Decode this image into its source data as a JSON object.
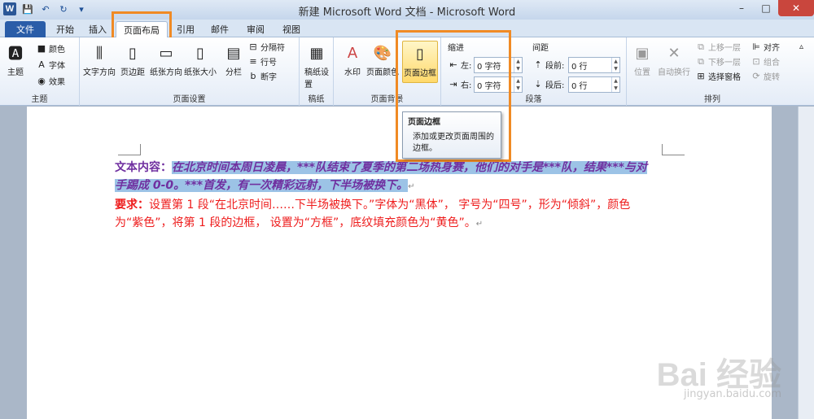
{
  "title": "新建 Microsoft Word 文档 - Microsoft Word",
  "qat": {
    "logo": "W",
    "save": "💾",
    "undo": "↶",
    "redo": "↻",
    "more": "▾"
  },
  "window": {
    "min": "–",
    "max": "□",
    "close": "✕"
  },
  "tabs": [
    "文件",
    "开始",
    "插入",
    "页面布局",
    "引用",
    "邮件",
    "审阅",
    "视图"
  ],
  "ribbon": {
    "theme": {
      "btn": "主题",
      "colors": "颜色",
      "fonts": "字体",
      "effects": "效果",
      "label": "主题"
    },
    "page_setup": {
      "text_dir": "文字方向",
      "margins": "页边距",
      "orientation": "纸张方向",
      "size": "纸张大小",
      "columns": "分栏",
      "breaks": "分隔符",
      "line_numbers": "行号",
      "hyphenation": "断字",
      "label": "页面设置"
    },
    "draft": {
      "btn": "稿纸设置",
      "label": "稿纸"
    },
    "background": {
      "watermark": "水印",
      "page_color": "页面颜色",
      "page_border": "页面边框",
      "label": "页面背景"
    },
    "paragraph": {
      "indent": "缩进",
      "left": "左:",
      "right": "右:",
      "left_val": "0 字符",
      "right_val": "0 字符",
      "spacing": "间距",
      "before": "段前:",
      "after": "段后:",
      "before_val": "0 行",
      "after_val": "0 行",
      "label": "段落"
    },
    "arrange": {
      "position": "位置",
      "wrap": "自动换行",
      "bring_forward": "上移一层",
      "send_backward": "下移一层",
      "selection_pane": "选择窗格",
      "align": "对齐",
      "group": "组合",
      "rotate": "旋转",
      "label": "排列"
    }
  },
  "tooltip": {
    "title": "页面边框",
    "body": "添加或更改页面周围的边框。"
  },
  "doc": {
    "p1_label": "文本内容：",
    "p1_text": "在北京时间本周日凌晨，***队结束了夏季的第二场热身赛，他们的对手是***队，结果***与对手踢成 0-0。***首发，有一次精彩远射，下半场被换下。",
    "p2_label": "要求：",
    "p2_text": "设置第 1 段“在北京时间……下半场被换下。”字体为“黑体”，     字号为“四号”，形为“倾斜”，颜色为“紫色”，将第 1 段的边框，     设置为“方框”，底纹填充颜色为“黄色”。",
    "ret": "↵"
  },
  "watermark": {
    "big": "Bai 经验",
    "small": "jingyan.baidu.com"
  }
}
